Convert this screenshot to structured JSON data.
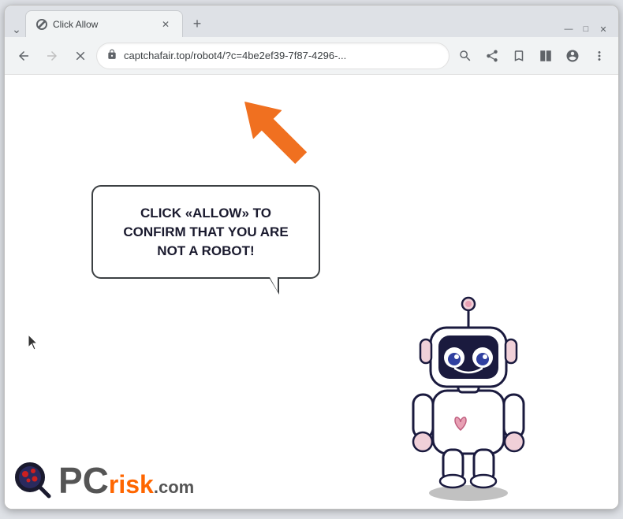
{
  "browser": {
    "tab": {
      "title": "Click Allow",
      "favicon": "🔒"
    },
    "new_tab_label": "+",
    "window_controls": {
      "minimize": "—",
      "maximize": "□",
      "close": "✕",
      "chevron": "⌄"
    },
    "nav": {
      "back": "←",
      "forward": "→",
      "reload": "✕"
    },
    "address": {
      "url": "captchafair.top/robot4/?c=4be2ef39-7f87-4296-...",
      "lock_icon": "🔒"
    },
    "toolbar_icons": {
      "search": "🔍",
      "share": "⎋",
      "bookmark": "☆",
      "split": "▣",
      "profile": "👤",
      "menu": "⋮"
    }
  },
  "content": {
    "bubble_text": "CLICK «ALLOW» TO CONFIRM THAT YOU ARE NOT A ROBOT!",
    "arrow_direction": "up-right",
    "robot_alt": "cartoon robot character"
  },
  "watermark": {
    "pc_text": "PC",
    "risk_text": "risk",
    "com_text": ".com"
  }
}
